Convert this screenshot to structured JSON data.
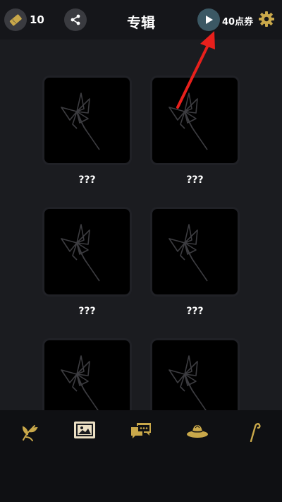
{
  "header": {
    "ticket_count": "10",
    "title": "专辑",
    "voucher_label": "40点券"
  },
  "album": {
    "items": [
      {
        "label": "???"
      },
      {
        "label": "???"
      },
      {
        "label": "???"
      },
      {
        "label": "???"
      },
      {
        "label": "???"
      },
      {
        "label": "???"
      }
    ]
  },
  "nav": {
    "items": [
      "plant-icon",
      "gallery-icon",
      "chat-icon",
      "hat-icon",
      "cane-icon"
    ],
    "active": "gallery-icon"
  },
  "colors": {
    "accent_gold": "#c9a84a",
    "play_button": "#3b5864",
    "annotation_arrow": "#e8201c"
  }
}
